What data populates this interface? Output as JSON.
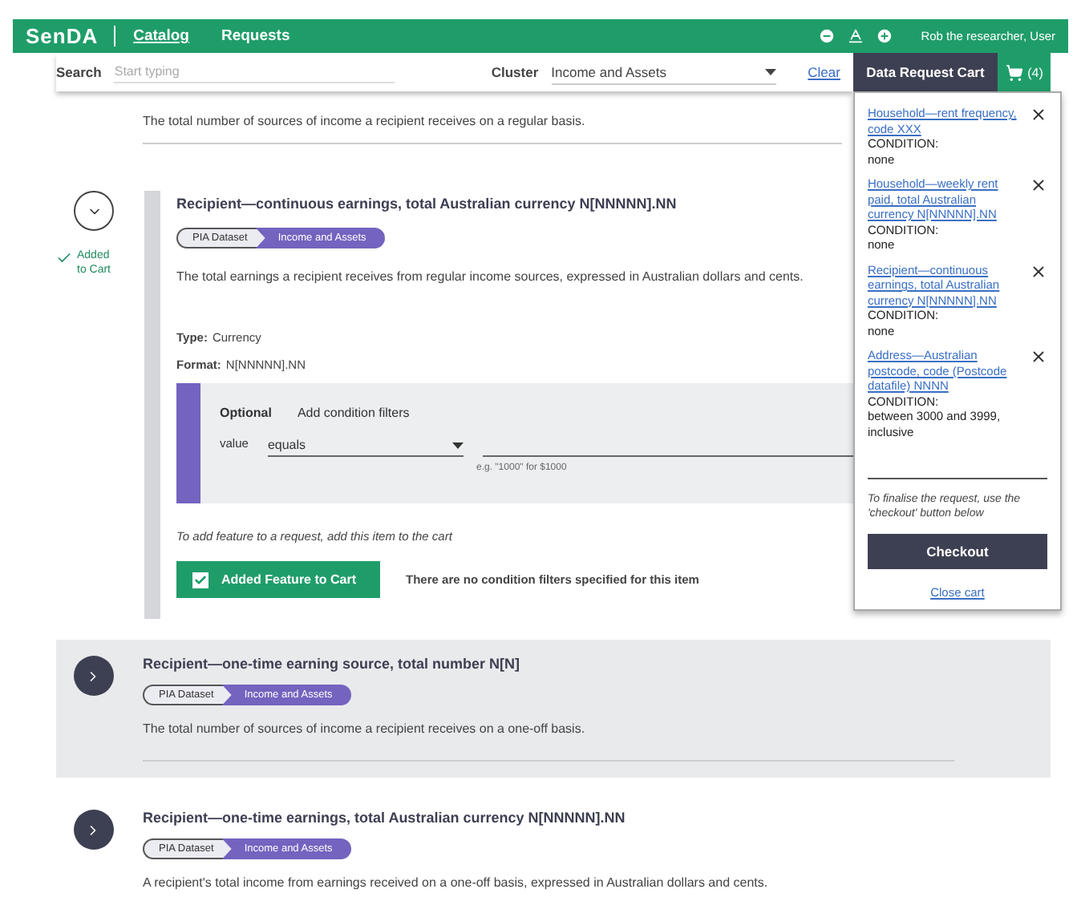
{
  "header": {
    "logo": "SenDA",
    "nav": [
      {
        "label": "Catalog",
        "selected": true
      },
      {
        "label": "Requests",
        "selected": false
      }
    ],
    "user": "Rob the researcher, User"
  },
  "search": {
    "label": "Search",
    "placeholder": "Start typing",
    "cluster_label": "Cluster",
    "cluster_value": "Income and Assets",
    "clear": "Clear"
  },
  "items": [
    {
      "kind": "partial",
      "description": "The total number of sources of income a recipient receives on a regular basis."
    },
    {
      "kind": "feature",
      "expanded": true,
      "highlighted": false,
      "in_cart": true,
      "added_label": "Added to Cart",
      "title": "Recipient—continuous earnings, total Australian currency N[NNNNN].NN",
      "tags": [
        "PIA Dataset",
        "Income and Assets"
      ],
      "description": "The total earnings a recipient receives from regular income sources, expressed in Australian dollars and cents.",
      "type_label": "Type:",
      "type": "Currency",
      "format_label": "Format:",
      "format": "N[NNNNN].NN",
      "filters": {
        "optional": "Optional",
        "title": "Add condition filters",
        "field_label": "value",
        "operator": "equals",
        "hint": "e.g. \"1000\" for $1000"
      },
      "note": "To add feature to a request, add this item to the cart",
      "cart_button": {
        "label": "Added Feature to Cart",
        "checked": true
      },
      "filter_status": "There are no condition filters specified for this item"
    },
    {
      "kind": "feature",
      "expanded": false,
      "highlighted": true,
      "in_cart": false,
      "title": "Recipient—one-time earning source, total number N[N]",
      "tags": [
        "PIA Dataset",
        "Income and Assets"
      ],
      "description": "The total number of sources of income a recipient receives on a one-off basis."
    },
    {
      "kind": "feature",
      "expanded": false,
      "highlighted": false,
      "in_cart": false,
      "title": "Recipient—one-time earnings, total Australian currency N[NNNNN].NN",
      "tags": [
        "PIA Dataset",
        "Income and Assets"
      ],
      "description": "A recipient's total income from earnings received on a one-off basis, expressed in Australian dollars and cents."
    }
  ],
  "cart": {
    "title": "Data Request Cart",
    "count": "(4)",
    "items": [
      {
        "name": "Household—rent frequency, code XXX",
        "condition_label": "CONDITION:",
        "condition": "none"
      },
      {
        "name": "Household—weekly rent paid, total Australian currency N[NNNNN].NN",
        "condition_label": "CONDITION:",
        "condition": "none"
      },
      {
        "name": "Recipient—continuous earnings, total Australian currency N[NNNNN].NN",
        "condition_label": "CONDITION:",
        "condition": "none"
      },
      {
        "name": "Address—Australian postcode, code (Postcode datafile) NNNN",
        "condition_label": "CONDITION:",
        "condition": "between 3000 and 3999, inclusive"
      }
    ],
    "note": "To finalise the request, use the 'checkout' button below",
    "checkout": "Checkout",
    "close": "Close cart"
  }
}
